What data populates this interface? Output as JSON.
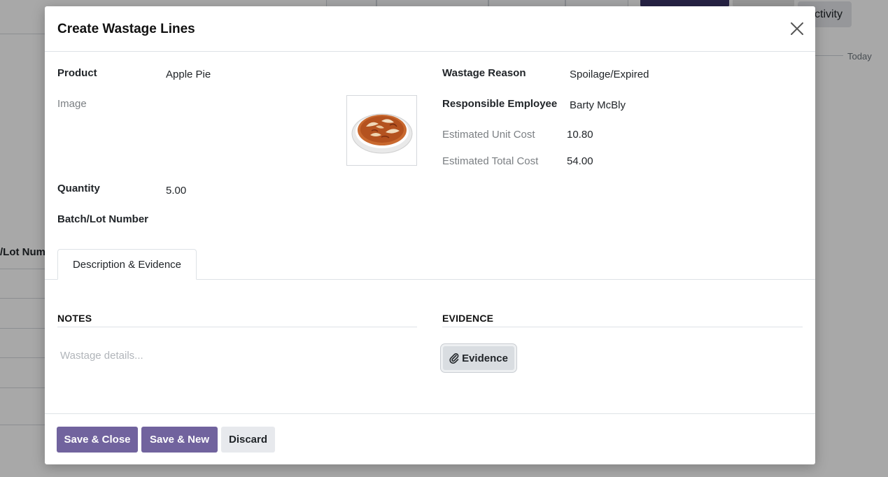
{
  "background": {
    "activity_label": "ctivity",
    "today_label": "Today",
    "lot_label": "/Lot Num"
  },
  "modal": {
    "title": "Create Wastage Lines",
    "close_icon": "close-icon"
  },
  "form": {
    "left": {
      "product_label": "Product",
      "product_value": "Apple Pie",
      "image_label": "Image",
      "image_icon": "apple-pie-image",
      "quantity_label": "Quantity",
      "quantity_value": "5.00",
      "batch_label": "Batch/Lot Number",
      "batch_value": ""
    },
    "right": {
      "reason_label": "Wastage Reason",
      "reason_value": "Spoilage/Expired",
      "employee_label": "Responsible Employee",
      "employee_value": "Barty McBly",
      "unit_cost_label": "Estimated Unit Cost",
      "unit_cost_value": "10.80",
      "total_cost_label": "Estimated Total Cost",
      "total_cost_value": "54.00"
    }
  },
  "tabs": [
    {
      "label": "Description & Evidence",
      "active": true
    }
  ],
  "notes": {
    "title": "NOTES",
    "placeholder": "Wastage details..."
  },
  "evidence": {
    "title": "EVIDENCE",
    "button_label": "Evidence",
    "button_icon": "paperclip-icon"
  },
  "footer": {
    "save_close_label": "Save & Close",
    "save_new_label": "Save & New",
    "discard_label": "Discard"
  },
  "colors": {
    "primary": "#71639e",
    "secondary": "#e7e9ed"
  }
}
